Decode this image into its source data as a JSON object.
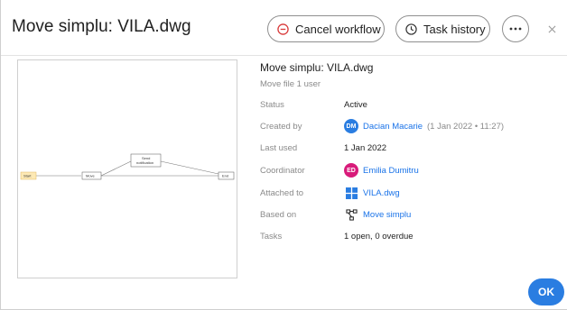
{
  "dialog": {
    "title": "Move simplu: VILA.dwg",
    "actions": {
      "cancel_label": "Cancel workflow",
      "history_label": "Task history",
      "more_icon": "more-horizontal-icon",
      "close_icon": "close-icon"
    }
  },
  "preview": {
    "nodes": {
      "start": "Start",
      "move": "Move",
      "send_line1": "Send",
      "send_line2": "notification",
      "end": "End"
    }
  },
  "details": {
    "title": "Move simplu: VILA.dwg",
    "subtitle": "Move file 1 user",
    "rows": {
      "status": {
        "label": "Status",
        "value": "Active"
      },
      "created_by": {
        "label": "Created by",
        "initials": "DM",
        "name": "Dacian Macarie",
        "meta": "(1 Jan 2022 • 11:27)",
        "avatar_color": "#2a7de1"
      },
      "last_used": {
        "label": "Last used",
        "value": "1 Jan 2022"
      },
      "coordinator": {
        "label": "Coordinator",
        "initials": "ED",
        "name": "Emilia Dumitru",
        "avatar_color": "#d81b7a"
      },
      "attached_to": {
        "label": "Attached to",
        "value": "VILA.dwg",
        "icon": "dwg-file-icon"
      },
      "based_on": {
        "label": "Based on",
        "value": "Move simplu",
        "icon": "workflow-icon"
      },
      "tasks": {
        "label": "Tasks",
        "value": "1 open, 0 overdue"
      }
    }
  },
  "footer": {
    "ok_label": "OK"
  },
  "colors": {
    "accent": "#2a7de1",
    "link": "#1a73e8",
    "start_node": "#fde9b5"
  }
}
